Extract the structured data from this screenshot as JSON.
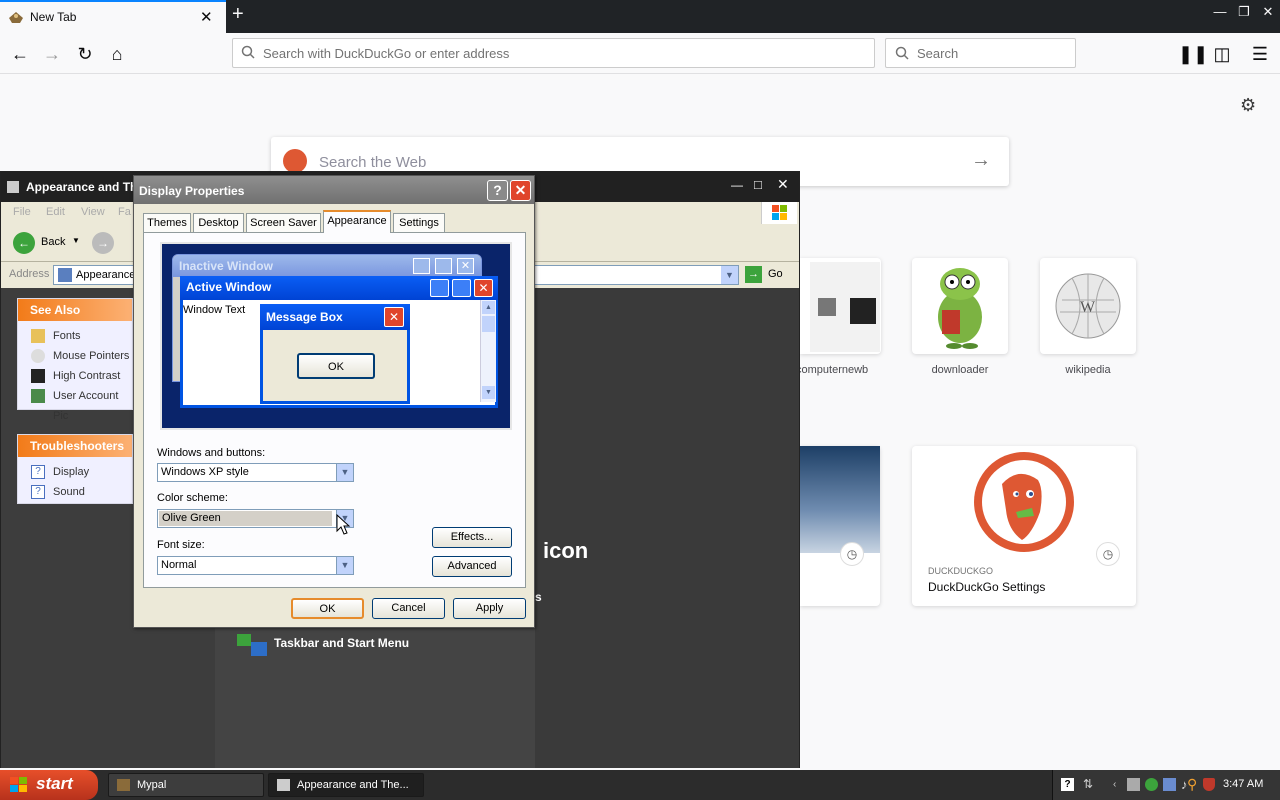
{
  "browser": {
    "tab_title": "New Tab",
    "tab_close": "✕",
    "new_tab": "+",
    "url_placeholder": "Search with DuckDuckGo or enter address",
    "search_placeholder": "Search",
    "web_search_placeholder": "Search the Web",
    "accent": "#0a84ff"
  },
  "top_sites": [
    {
      "label": "computernewb"
    },
    {
      "label": "downloader"
    },
    {
      "label": "wikipedia"
    }
  ],
  "highlights": [
    {
      "source": "DUCKDUCKGO",
      "title": "DuckDuckGo Settings"
    }
  ],
  "xp_window": {
    "title": "Appearance and Th",
    "menu": [
      "File",
      "Edit",
      "View",
      "Fa"
    ],
    "back_label": "Back",
    "address_label": "Address",
    "address_value": "Appearance",
    "go_label": "Go",
    "see_also_header": "See Also",
    "see_also_items": [
      "Fonts",
      "Mouse Pointers",
      "High Contrast",
      "User Account Pic"
    ],
    "troubleshooters_header": "Troubleshooters",
    "troubleshooter_items": [
      "Display",
      "Sound"
    ],
    "icon_heading": "icon",
    "partial_text": "s",
    "taskbar_link": "Taskbar and Start Menu"
  },
  "dialog": {
    "title": "Display Properties",
    "help": "?",
    "close": "✕",
    "tabs": [
      "Themes",
      "Desktop",
      "Screen Saver",
      "Appearance",
      "Settings"
    ],
    "preview": {
      "inactive_title": "Inactive Window",
      "active_title": "Active Window",
      "window_text": "Window Text",
      "message_title": "Message Box",
      "message_ok": "OK"
    },
    "windows_buttons_label": "Windows and buttons:",
    "windows_buttons_value": "Windows XP style",
    "color_scheme_label": "Color scheme:",
    "color_scheme_value": "Olive Green",
    "font_size_label": "Font size:",
    "font_size_value": "Normal",
    "effects_label": "Effects...",
    "advanced_label": "Advanced",
    "ok_label": "OK",
    "cancel_label": "Cancel",
    "apply_label": "Apply"
  },
  "taskbar": {
    "start_label": "start",
    "items": [
      "Mypal",
      "Appearance and The..."
    ],
    "clock": "3:47 AM"
  }
}
